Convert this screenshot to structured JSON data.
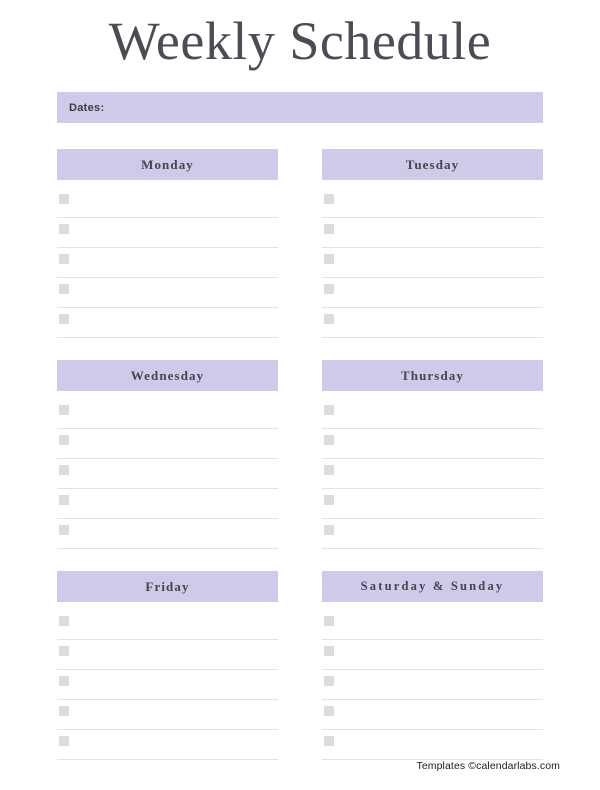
{
  "page": {
    "title": "Weekly Schedule"
  },
  "dates": {
    "label": "Dates:",
    "value": ""
  },
  "theme": {
    "accent": "#cfc9ea",
    "title_color": "#4c4c55",
    "checkbox_color": "#dcdcdc",
    "rule_color": "#e2e2e2"
  },
  "days": [
    {
      "label": "Monday",
      "rows": [
        "",
        "",
        "",
        "",
        ""
      ]
    },
    {
      "label": "Tuesday",
      "rows": [
        "",
        "",
        "",
        "",
        ""
      ]
    },
    {
      "label": "Wednesday",
      "rows": [
        "",
        "",
        "",
        "",
        ""
      ]
    },
    {
      "label": "Thursday",
      "rows": [
        "",
        "",
        "",
        "",
        ""
      ]
    },
    {
      "label": "Friday",
      "rows": [
        "",
        "",
        "",
        "",
        ""
      ]
    },
    {
      "label": "Saturday & Sunday",
      "rows": [
        "",
        "",
        "",
        "",
        ""
      ]
    }
  ],
  "footer": {
    "credit": "Templates ©calendarlabs.com"
  }
}
